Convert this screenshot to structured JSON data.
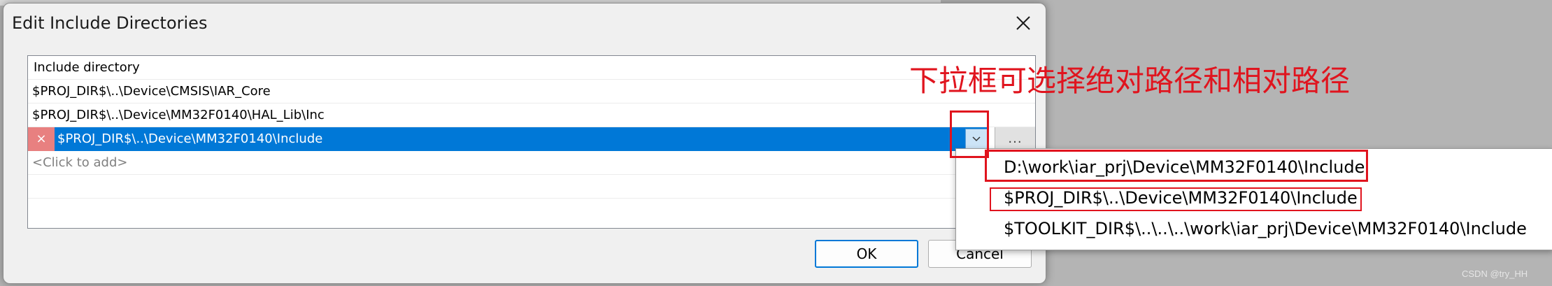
{
  "dialog": {
    "title": "Edit Include Directories",
    "list": {
      "header": "Include directory",
      "rows": [
        "$PROJ_DIR$\\..\\Device\\CMSIS\\IAR_Core",
        "$PROJ_DIR$\\..\\Device\\MM32F0140\\HAL_Lib\\Inc"
      ],
      "selected_value": "$PROJ_DIR$\\..\\Device\\MM32F0140\\Include",
      "delete_glyph": "×",
      "browse_label": "...",
      "placeholder": "<Click to add>"
    },
    "buttons": {
      "ok": "OK",
      "cancel": "Cancel"
    }
  },
  "dropdown": {
    "options": [
      "D:\\work\\iar_prj\\Device\\MM32F0140\\Include",
      "$PROJ_DIR$\\..\\Device\\MM32F0140\\Include",
      "$TOOLKIT_DIR$\\..\\..\\..\\work\\iar_prj\\Device\\MM32F0140\\Include"
    ]
  },
  "annotation": {
    "text": "下拉框可选择绝对路径和相对路径"
  },
  "watermark": "CSDN @try_HH",
  "colors": {
    "selection": "#0078d7",
    "annotation_red": "#e0141e",
    "delete_red": "#e88080"
  },
  "icons": {
    "close": "close-icon",
    "dropdown": "chevron-down-icon"
  }
}
